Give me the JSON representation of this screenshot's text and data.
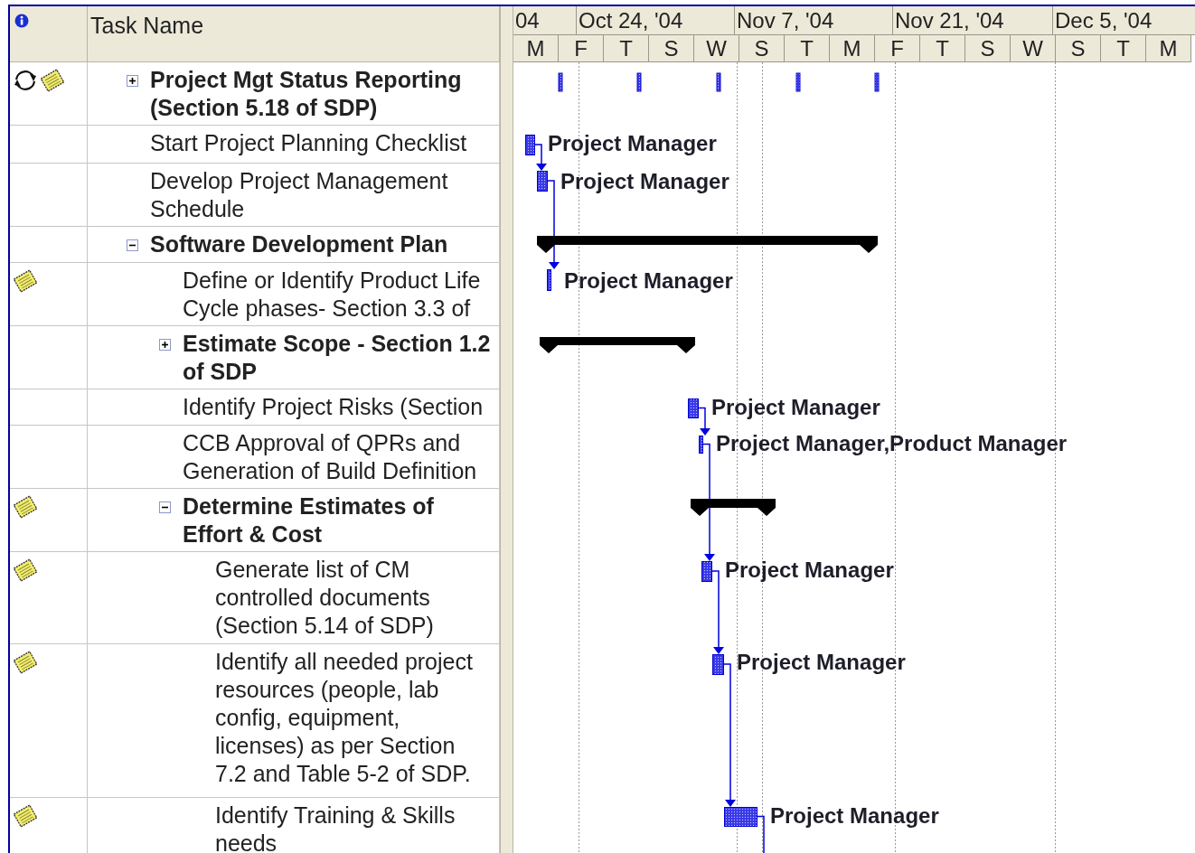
{
  "columns": {
    "task_name": "Task Name"
  },
  "timescale": {
    "major": [
      "04",
      "Oct 24, '04",
      "Nov 7, '04",
      "Nov 21, '04",
      "Dec 5, '04"
    ],
    "minor": [
      "M",
      "F",
      "T",
      "S",
      "W",
      "S",
      "T",
      "M",
      "F",
      "T",
      "S",
      "W",
      "S",
      "T",
      "M"
    ]
  },
  "tasks": [
    {
      "name": "Project Mgt Status Reporting (Section 5.18 of SDP)",
      "summary": true,
      "expanded": false,
      "indicators": [
        {
          "kind": "recurring"
        },
        {
          "kind": "note"
        }
      ],
      "bar": {
        "kind": "recurring"
      }
    },
    {
      "name": "Start Project Planning Checklist",
      "summary": false,
      "bar": {
        "kind": "task"
      },
      "resource": "Project Manager"
    },
    {
      "name": "Develop Project Management Schedule",
      "summary": false,
      "bar": {
        "kind": "task"
      },
      "resource": "Project Manager"
    },
    {
      "name": "Software Development Plan",
      "summary": true,
      "expanded": true,
      "bar": {
        "kind": "summary"
      },
      "children": [
        {
          "name": "Define or Identify Product Life Cycle phases- Section 3.3 of",
          "summary": false,
          "indicators": [
            {
              "kind": "note"
            }
          ],
          "bar": {
            "kind": "task"
          },
          "resource": "Project Manager"
        },
        {
          "name": "Estimate Scope - Section 1.2 of SDP",
          "summary": true,
          "expanded": false,
          "bar": {
            "kind": "summary"
          }
        },
        {
          "name": "Identify Project Risks (Section",
          "summary": false,
          "bar": {
            "kind": "task"
          },
          "resource": "Project Manager"
        },
        {
          "name": "CCB Approval of QPRs and Generation of Build Definition",
          "summary": false,
          "bar": {
            "kind": "task"
          },
          "resource": "Project Manager,Product Manager"
        },
        {
          "name": "Determine Estimates of Effort & Cost",
          "summary": true,
          "expanded": true,
          "indicators": [
            {
              "kind": "note"
            }
          ],
          "bar": {
            "kind": "summary"
          },
          "children": [
            {
              "name": "Generate list of CM controlled documents (Section 5.14 of SDP)",
              "summary": false,
              "indicators": [
                {
                  "kind": "note"
                }
              ],
              "bar": {
                "kind": "task"
              },
              "resource": "Project Manager"
            },
            {
              "name": "Identify all needed project resources (people, lab config, equipment, licenses) as per Section 7.2 and Table 5-2 of SDP.",
              "summary": false,
              "indicators": [
                {
                  "kind": "note"
                }
              ],
              "bar": {
                "kind": "task"
              },
              "resource": "Project Manager"
            },
            {
              "name": "Identify Training & Skills needs",
              "summary": false,
              "indicators": [
                {
                  "kind": "note"
                }
              ],
              "bar": {
                "kind": "task"
              },
              "resource": "Project Manager"
            }
          ]
        }
      ]
    }
  ]
}
